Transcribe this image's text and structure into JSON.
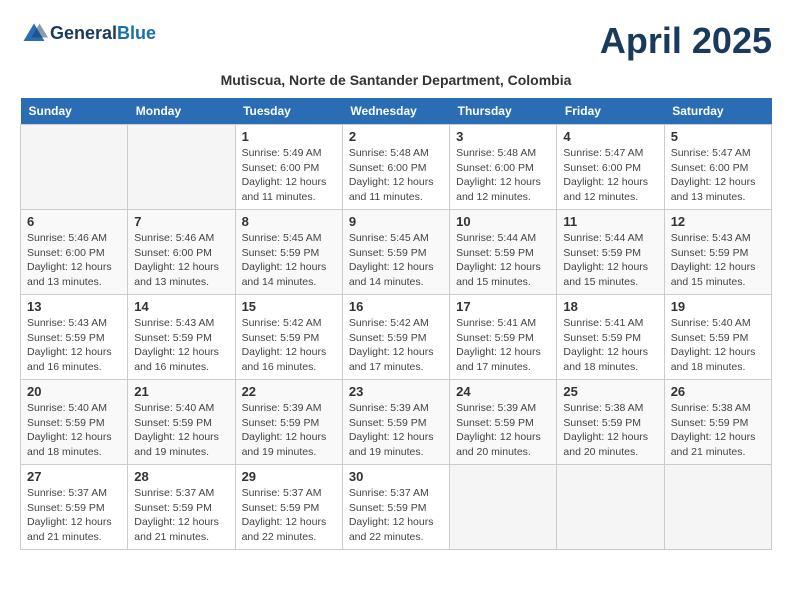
{
  "logo": {
    "line1": "General",
    "line2": "Blue"
  },
  "title": "April 2025",
  "subtitle": "Mutiscua, Norte de Santander Department, Colombia",
  "days_of_week": [
    "Sunday",
    "Monday",
    "Tuesday",
    "Wednesday",
    "Thursday",
    "Friday",
    "Saturday"
  ],
  "weeks": [
    [
      {
        "day": "",
        "info": ""
      },
      {
        "day": "",
        "info": ""
      },
      {
        "day": "1",
        "info": "Sunrise: 5:49 AM\nSunset: 6:00 PM\nDaylight: 12 hours\nand 11 minutes."
      },
      {
        "day": "2",
        "info": "Sunrise: 5:48 AM\nSunset: 6:00 PM\nDaylight: 12 hours\nand 11 minutes."
      },
      {
        "day": "3",
        "info": "Sunrise: 5:48 AM\nSunset: 6:00 PM\nDaylight: 12 hours\nand 12 minutes."
      },
      {
        "day": "4",
        "info": "Sunrise: 5:47 AM\nSunset: 6:00 PM\nDaylight: 12 hours\nand 12 minutes."
      },
      {
        "day": "5",
        "info": "Sunrise: 5:47 AM\nSunset: 6:00 PM\nDaylight: 12 hours\nand 13 minutes."
      }
    ],
    [
      {
        "day": "6",
        "info": "Sunrise: 5:46 AM\nSunset: 6:00 PM\nDaylight: 12 hours\nand 13 minutes."
      },
      {
        "day": "7",
        "info": "Sunrise: 5:46 AM\nSunset: 6:00 PM\nDaylight: 12 hours\nand 13 minutes."
      },
      {
        "day": "8",
        "info": "Sunrise: 5:45 AM\nSunset: 5:59 PM\nDaylight: 12 hours\nand 14 minutes."
      },
      {
        "day": "9",
        "info": "Sunrise: 5:45 AM\nSunset: 5:59 PM\nDaylight: 12 hours\nand 14 minutes."
      },
      {
        "day": "10",
        "info": "Sunrise: 5:44 AM\nSunset: 5:59 PM\nDaylight: 12 hours\nand 15 minutes."
      },
      {
        "day": "11",
        "info": "Sunrise: 5:44 AM\nSunset: 5:59 PM\nDaylight: 12 hours\nand 15 minutes."
      },
      {
        "day": "12",
        "info": "Sunrise: 5:43 AM\nSunset: 5:59 PM\nDaylight: 12 hours\nand 15 minutes."
      }
    ],
    [
      {
        "day": "13",
        "info": "Sunrise: 5:43 AM\nSunset: 5:59 PM\nDaylight: 12 hours\nand 16 minutes."
      },
      {
        "day": "14",
        "info": "Sunrise: 5:43 AM\nSunset: 5:59 PM\nDaylight: 12 hours\nand 16 minutes."
      },
      {
        "day": "15",
        "info": "Sunrise: 5:42 AM\nSunset: 5:59 PM\nDaylight: 12 hours\nand 16 minutes."
      },
      {
        "day": "16",
        "info": "Sunrise: 5:42 AM\nSunset: 5:59 PM\nDaylight: 12 hours\nand 17 minutes."
      },
      {
        "day": "17",
        "info": "Sunrise: 5:41 AM\nSunset: 5:59 PM\nDaylight: 12 hours\nand 17 minutes."
      },
      {
        "day": "18",
        "info": "Sunrise: 5:41 AM\nSunset: 5:59 PM\nDaylight: 12 hours\nand 18 minutes."
      },
      {
        "day": "19",
        "info": "Sunrise: 5:40 AM\nSunset: 5:59 PM\nDaylight: 12 hours\nand 18 minutes."
      }
    ],
    [
      {
        "day": "20",
        "info": "Sunrise: 5:40 AM\nSunset: 5:59 PM\nDaylight: 12 hours\nand 18 minutes."
      },
      {
        "day": "21",
        "info": "Sunrise: 5:40 AM\nSunset: 5:59 PM\nDaylight: 12 hours\nand 19 minutes."
      },
      {
        "day": "22",
        "info": "Sunrise: 5:39 AM\nSunset: 5:59 PM\nDaylight: 12 hours\nand 19 minutes."
      },
      {
        "day": "23",
        "info": "Sunrise: 5:39 AM\nSunset: 5:59 PM\nDaylight: 12 hours\nand 19 minutes."
      },
      {
        "day": "24",
        "info": "Sunrise: 5:39 AM\nSunset: 5:59 PM\nDaylight: 12 hours\nand 20 minutes."
      },
      {
        "day": "25",
        "info": "Sunrise: 5:38 AM\nSunset: 5:59 PM\nDaylight: 12 hours\nand 20 minutes."
      },
      {
        "day": "26",
        "info": "Sunrise: 5:38 AM\nSunset: 5:59 PM\nDaylight: 12 hours\nand 21 minutes."
      }
    ],
    [
      {
        "day": "27",
        "info": "Sunrise: 5:37 AM\nSunset: 5:59 PM\nDaylight: 12 hours\nand 21 minutes."
      },
      {
        "day": "28",
        "info": "Sunrise: 5:37 AM\nSunset: 5:59 PM\nDaylight: 12 hours\nand 21 minutes."
      },
      {
        "day": "29",
        "info": "Sunrise: 5:37 AM\nSunset: 5:59 PM\nDaylight: 12 hours\nand 22 minutes."
      },
      {
        "day": "30",
        "info": "Sunrise: 5:37 AM\nSunset: 5:59 PM\nDaylight: 12 hours\nand 22 minutes."
      },
      {
        "day": "",
        "info": ""
      },
      {
        "day": "",
        "info": ""
      },
      {
        "day": "",
        "info": ""
      }
    ]
  ]
}
